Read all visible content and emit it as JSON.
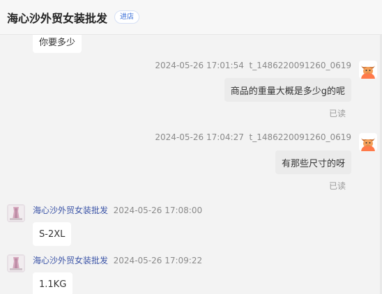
{
  "header": {
    "shop_name": "海心沙外贸女装批发",
    "enter_label": "进店"
  },
  "messages": [
    {
      "text": "你要多少"
    },
    {
      "timestamp": "2024-05-26 17:01:54",
      "user": "t_1486220091260_0619",
      "text": "商品的重量大概是多少g的呢",
      "status": "已读"
    },
    {
      "timestamp": "2024-05-26 17:04:27",
      "user": "t_1486220091260_0619",
      "text": "有那些尺寸的呀",
      "status": "已读"
    },
    {
      "sender": "海心沙外贸女装批发",
      "timestamp": "2024-05-26 17:08:00",
      "text": "S-2XL"
    },
    {
      "sender": "海心沙外贸女装批发",
      "timestamp": "2024-05-26 17:09:22",
      "text": "1.1KG"
    }
  ],
  "colors": {
    "sender_link": "#3b54a7",
    "outgoing_bubble": "#ebebeb",
    "incoming_bubble": "#ffffff",
    "avatar_user_accent": "#ff7a4a"
  }
}
